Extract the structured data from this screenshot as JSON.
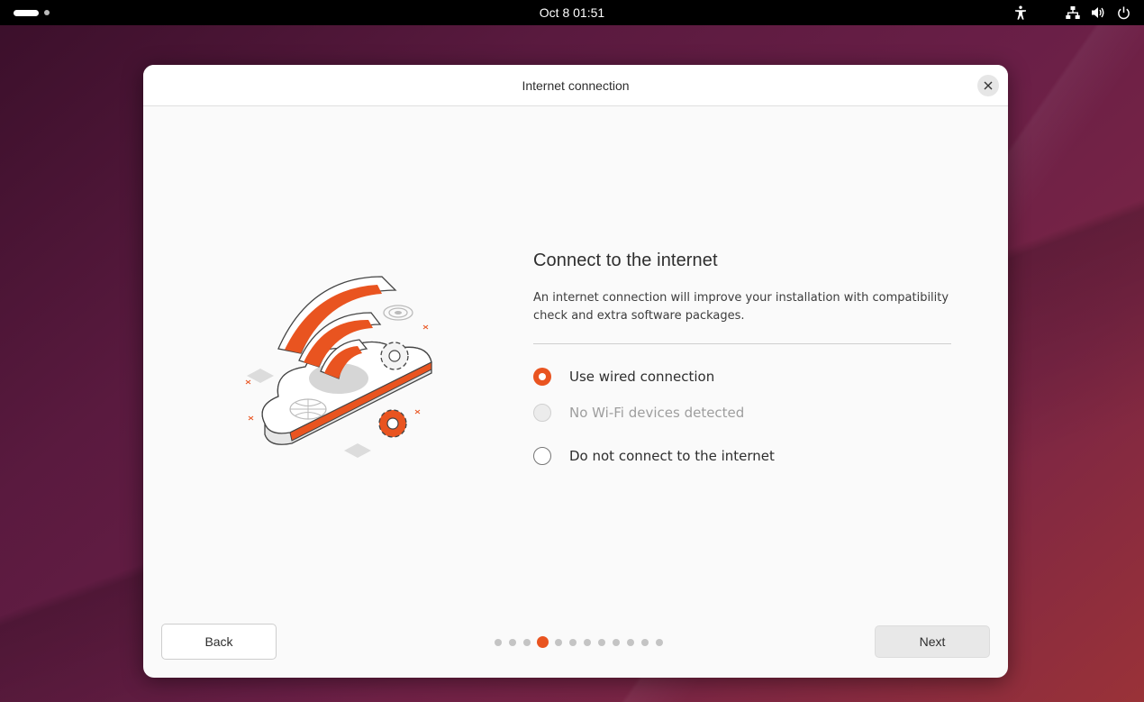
{
  "topbar": {
    "clock": "Oct 8  01:51",
    "icons": [
      "activities-indicator",
      "accessibility-icon",
      "network-wired-icon",
      "volume-icon",
      "power-icon"
    ]
  },
  "dialog": {
    "title": "Internet connection",
    "close_icon": "close-icon"
  },
  "main": {
    "heading": "Connect to the internet",
    "description": "An internet connection will improve your installation with compatibility check and extra software packages.",
    "options": [
      {
        "label": "Use wired connection",
        "state": "selected"
      },
      {
        "label": "No Wi-Fi devices detected",
        "state": "disabled"
      },
      {
        "label": "Do not connect to the internet",
        "state": "unselected"
      }
    ]
  },
  "footer": {
    "back_label": "Back",
    "next_label": "Next",
    "steps_total": 12,
    "current_step": 4
  },
  "colors": {
    "accent": "#e95420",
    "topbar": "#000000",
    "dialog_bg": "#fafafa"
  }
}
